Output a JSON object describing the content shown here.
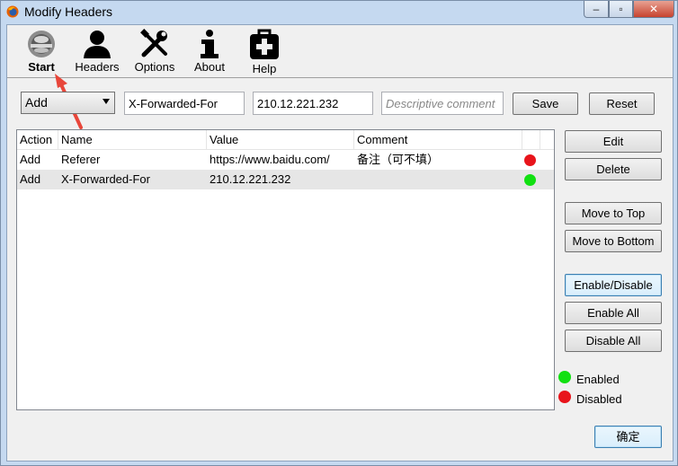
{
  "window": {
    "title": "Modify Headers",
    "min_symbol": "–",
    "max_symbol": "▫",
    "close_symbol": "✕"
  },
  "toolbar": {
    "start": "Start",
    "headers": "Headers",
    "options": "Options",
    "about": "About",
    "help": "Help"
  },
  "form": {
    "action_value": "Add",
    "name_value": "X-Forwarded-For",
    "value_value": "210.12.221.232",
    "comment_placeholder": "Descriptive comment",
    "save_label": "Save",
    "reset_label": "Reset"
  },
  "table": {
    "columns": [
      "Action",
      "Name",
      "Value",
      "Comment"
    ],
    "rows": [
      {
        "action": "Add",
        "name": "Referer",
        "value": "https://www.baidu.com/",
        "comment": "备注（可不填）",
        "status": "disabled"
      },
      {
        "action": "Add",
        "name": "X-Forwarded-For",
        "value": "210.12.221.232",
        "comment": "",
        "status": "enabled"
      }
    ]
  },
  "side_buttons": {
    "edit": "Edit",
    "delete": "Delete",
    "move_top": "Move to Top",
    "move_bottom": "Move to Bottom",
    "enable_disable": "Enable/Disable",
    "enable_all": "Enable All",
    "disable_all": "Disable All"
  },
  "legend": {
    "enabled": "Enabled",
    "disabled": "Disabled"
  },
  "ok_label": "确定",
  "colors": {
    "enabled": "#11e011",
    "disabled": "#e8141b",
    "arrow": "#e8463a"
  }
}
